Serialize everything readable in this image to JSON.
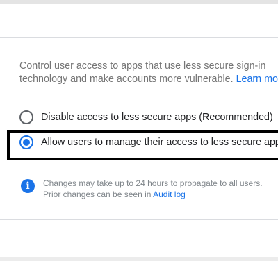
{
  "description": {
    "line1": "Control user access to apps that use less secure sign-in",
    "line2": "technology and make accounts more vulnerable.",
    "learn_more": "Learn more"
  },
  "options": [
    {
      "label": "Disable access to less secure apps (Recommended)",
      "selected": false
    },
    {
      "label": "Allow users to manage their access to less secure apps",
      "selected": true
    }
  ],
  "notice": {
    "line1": "Changes may take up to 24 hours to propagate to all users.",
    "line2": "Prior changes can be seen in",
    "audit_log": "Audit log"
  },
  "icons": {
    "info": "info-icon"
  },
  "colors": {
    "accent": "#1a73e8",
    "highlight_border": "#000000"
  }
}
